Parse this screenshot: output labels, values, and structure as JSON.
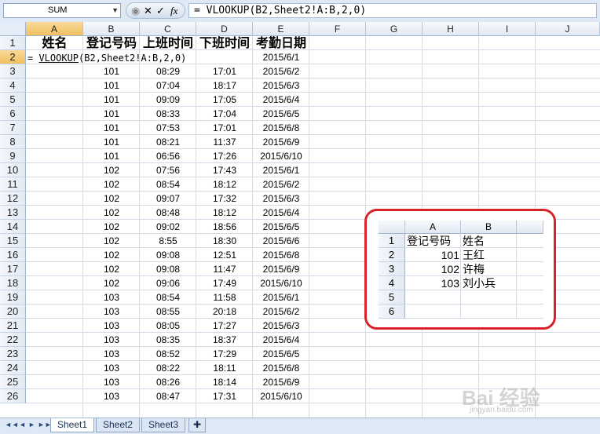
{
  "formula_bar": {
    "name_box": "SUM",
    "buttons": [
      "✕",
      "✓",
      "fx"
    ],
    "formula": "= VLOOKUP(B2,Sheet2!A:B,2,0)"
  },
  "columns": [
    "A",
    "B",
    "C",
    "D",
    "E",
    "F",
    "G",
    "H",
    "I",
    "J"
  ],
  "header_row": [
    "姓名",
    "登记号码",
    "上班时间",
    "下班时间",
    "考勤日期"
  ],
  "edit_cell": {
    "prefix": "= ",
    "fn": "VLOOKUP",
    "args": "(B2,Sheet2!A:B,2,0)"
  },
  "row2_date": "2015/6/1",
  "rows": [
    [
      "101",
      "08:29",
      "17:01",
      "2015/6/2"
    ],
    [
      "101",
      "07:04",
      "18:17",
      "2015/6/3"
    ],
    [
      "101",
      "09:09",
      "17:05",
      "2015/6/4"
    ],
    [
      "101",
      "08:33",
      "17:04",
      "2015/6/5"
    ],
    [
      "101",
      "07:53",
      "17:01",
      "2015/6/8"
    ],
    [
      "101",
      "08:21",
      "11:37",
      "2015/6/9"
    ],
    [
      "101",
      "06:56",
      "17:26",
      "2015/6/10"
    ],
    [
      "102",
      "07:56",
      "17:43",
      "2015/6/1"
    ],
    [
      "102",
      "08:54",
      "18:12",
      "2015/6/2"
    ],
    [
      "102",
      "09:07",
      "17:32",
      "2015/6/3"
    ],
    [
      "102",
      "08:48",
      "18:12",
      "2015/6/4"
    ],
    [
      "102",
      "09:02",
      "18:56",
      "2015/6/5"
    ],
    [
      "102",
      "8:55",
      "18:30",
      "2015/6/6"
    ],
    [
      "102",
      "09:08",
      "12:51",
      "2015/6/8"
    ],
    [
      "102",
      "09:08",
      "11:47",
      "2015/6/9"
    ],
    [
      "102",
      "09:06",
      "17:49",
      "2015/6/10"
    ],
    [
      "103",
      "08:54",
      "11:58",
      "2015/6/1"
    ],
    [
      "103",
      "08:55",
      "20:18",
      "2015/6/2"
    ],
    [
      "103",
      "08:05",
      "17:27",
      "2015/6/3"
    ],
    [
      "103",
      "08:35",
      "18:37",
      "2015/6/4"
    ],
    [
      "103",
      "08:52",
      "17:29",
      "2015/6/5"
    ],
    [
      "103",
      "08:22",
      "18:11",
      "2015/6/8"
    ],
    [
      "103",
      "08:26",
      "18:14",
      "2015/6/9"
    ],
    [
      "103",
      "08:47",
      "17:31",
      "2015/6/10"
    ]
  ],
  "row_numbers": [
    "1",
    "2",
    "3",
    "4",
    "5",
    "6",
    "7",
    "8",
    "9",
    "10",
    "11",
    "12",
    "13",
    "14",
    "15",
    "16",
    "17",
    "18",
    "19",
    "20",
    "21",
    "22",
    "23",
    "24",
    "25",
    "26"
  ],
  "inset": {
    "columns": [
      "A",
      "B"
    ],
    "row_numbers": [
      "1",
      "2",
      "3",
      "4",
      "5",
      "6"
    ],
    "rows": [
      [
        "登记号码",
        "姓名"
      ],
      [
        "101",
        "王红"
      ],
      [
        "102",
        "许梅"
      ],
      [
        "103",
        "刘小兵"
      ],
      [
        "",
        ""
      ],
      [
        "",
        ""
      ]
    ]
  },
  "sheet_tabs": [
    "Sheet1",
    "Sheet2",
    "Sheet3"
  ],
  "nav_buttons": [
    "◄◄",
    "◄",
    "►",
    "►►"
  ],
  "watermark": {
    "main": "Bai 经验",
    "sub": "jingyan.baidu.com"
  },
  "colors": {
    "accent_red": "#d9232b",
    "header_bg": "#dfe8f5",
    "selected_header": "#f1c15f"
  }
}
